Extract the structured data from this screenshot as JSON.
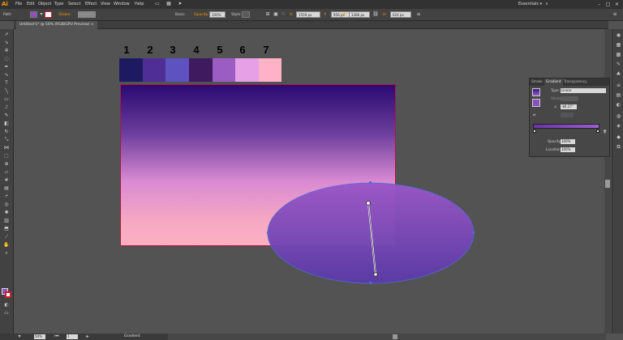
{
  "app": {
    "logo": "Ai",
    "workspace": "Essentials ▾"
  },
  "menu": [
    "File",
    "Edit",
    "Object",
    "Type",
    "Select",
    "Effect",
    "View",
    "Window",
    "Help"
  ],
  "control_bar": {
    "object_type": "Path",
    "stroke_label": "Stroke:",
    "brush_label": "Basic",
    "opacity_label": "Opacity:",
    "opacity_value": "100%",
    "style_label": "Style:",
    "x_label": "X:",
    "x_value": "1559 px",
    "y_label": "Y:",
    "y_value": "956 px",
    "w_label": "W:",
    "w_value": "1286 px",
    "h_label": "H:",
    "h_value": "624 px"
  },
  "document_tab": {
    "title": "Untitled-1* @ 50% (RGB/GPU Preview)  ×"
  },
  "swatches": {
    "labels": [
      "1",
      "2",
      "3",
      "4",
      "5",
      "6",
      "7"
    ],
    "colors": [
      "#1e1a62",
      "#4f2f96",
      "#5e52c0",
      "#3f1a5f",
      "#9b5cc4",
      "#e6a0e6",
      "#ffb1c7"
    ]
  },
  "gradient_panel": {
    "tabs": [
      "Stroke",
      "Gradient",
      "Transparency"
    ],
    "type_label": "Type:",
    "type_value": "Linear",
    "stroke_label": "Stroke:",
    "angle_value": "-84.27°",
    "opacity_label": "Opacity:",
    "opacity_value": "100%",
    "location_label": "Location:",
    "location_value": "100%"
  },
  "status_bar": {
    "zoom": "50%",
    "page": "1",
    "tool": "Gradient"
  },
  "colors": {
    "fill": "#8e4fc0",
    "stroke": "#d01d2a",
    "artboard_border": "#b0173a",
    "ellipse": "#8a4fc0"
  }
}
